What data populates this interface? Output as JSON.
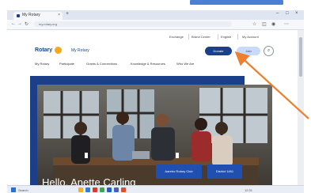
{
  "browser": {
    "tab_title": "My Rotary",
    "new_tab": "+",
    "url": "my.rotary.org",
    "window_controls": [
      "–",
      "□",
      "×"
    ]
  },
  "site": {
    "logo": "Rotary",
    "logo_subtitle": "My Rotary",
    "utility": {
      "exchange": "Exchange",
      "brand_center": "Brand Center",
      "language": "English",
      "account": "My Account"
    },
    "buttons": {
      "primary": "Donate",
      "secondary": "Join"
    },
    "menu": [
      "My Rotary",
      "Participate",
      "Grants & Connections",
      "Knowledge & Resources",
      "Who We Are"
    ],
    "hero": {
      "welcome": "Hello, Anette Carling",
      "club_pill": "Aarebo Rotary Club",
      "district_pill": "District 1461"
    }
  },
  "taskbar": {
    "search": "Search",
    "time": "12:31"
  },
  "colors": {
    "brand_blue": "#17458f",
    "hero_blue": "#1c3f8a",
    "gold": "#f7a81b",
    "arrow": "#ee7f2d"
  }
}
